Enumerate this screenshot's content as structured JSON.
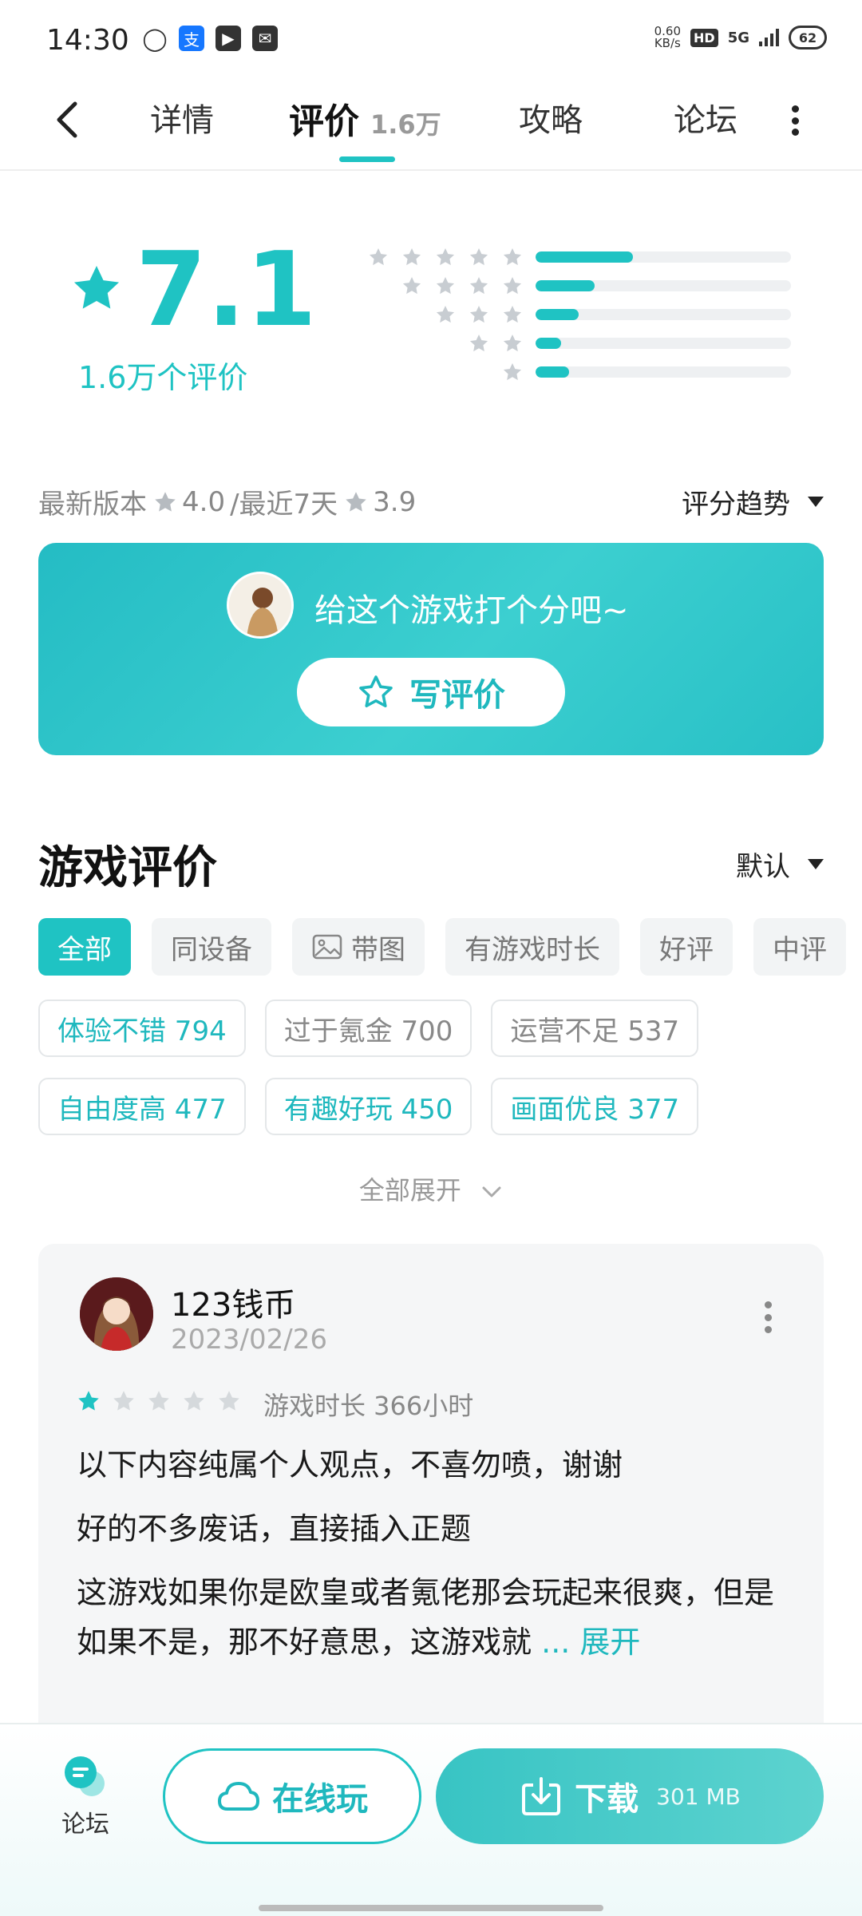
{
  "status_bar": {
    "time": "14:30",
    "speed_value": "0.60",
    "speed_unit": "KB/s",
    "hd_label": "HD",
    "network": "5G",
    "battery": "62"
  },
  "tabs": [
    {
      "label": "详情"
    },
    {
      "label": "评价",
      "count": "1.6万",
      "active": true
    },
    {
      "label": "攻略"
    },
    {
      "label": "论坛"
    }
  ],
  "rating": {
    "score": "7.1",
    "count_label": "1.6万个评价",
    "distribution": [
      {
        "stars": 5,
        "fraction": 0.38
      },
      {
        "stars": 4,
        "fraction": 0.23
      },
      {
        "stars": 3,
        "fraction": 0.17
      },
      {
        "stars": 2,
        "fraction": 0.1
      },
      {
        "stars": 1,
        "fraction": 0.13
      }
    ],
    "latest_version_label": "最新版本",
    "latest_version_score": "4.0",
    "recent_label": "/最近7天",
    "recent_score": "3.9",
    "trend_label": "评分趋势"
  },
  "banner": {
    "prompt": "给这个游戏打个分吧~",
    "button_label": "写评价"
  },
  "reviews": {
    "title": "游戏评价",
    "sort_label": "默认",
    "filters": [
      {
        "label": "全部",
        "active": true
      },
      {
        "label": "同设备"
      },
      {
        "label": "带图",
        "icon": "image-icon"
      },
      {
        "label": "有游戏时长"
      },
      {
        "label": "好评"
      },
      {
        "label": "中评"
      }
    ],
    "tags": [
      {
        "label": "体验不错 794",
        "tone": "pos"
      },
      {
        "label": "过于氪金 700",
        "tone": "neg"
      },
      {
        "label": "运营不足 537",
        "tone": "neg"
      },
      {
        "label": "自由度高 477",
        "tone": "pos"
      },
      {
        "label": "有趣好玩 450",
        "tone": "pos"
      },
      {
        "label": "画面优良 377",
        "tone": "pos"
      }
    ],
    "expand_all_label": "全部展开",
    "items": [
      {
        "username": "123钱币",
        "date": "2023/02/26",
        "stars": 1,
        "playtime": "游戏时长 366小时",
        "paragraphs": [
          "以下内容纯属个人观点，不喜勿喷，谢谢",
          "好的不多废话，直接插入正题",
          "这游戏如果你是欧皇或者氪佬那会玩起来很爽，但是如果不是，那不好意思，这游戏就"
        ],
        "expand_label": "... 展开"
      }
    ]
  },
  "bottom_bar": {
    "forum_label": "论坛",
    "online_label": "在线玩",
    "download_label": "下载",
    "download_size": "301 MB"
  },
  "colors": {
    "accent": "#1fc3c3",
    "star_inactive": "#c8cdd2"
  }
}
